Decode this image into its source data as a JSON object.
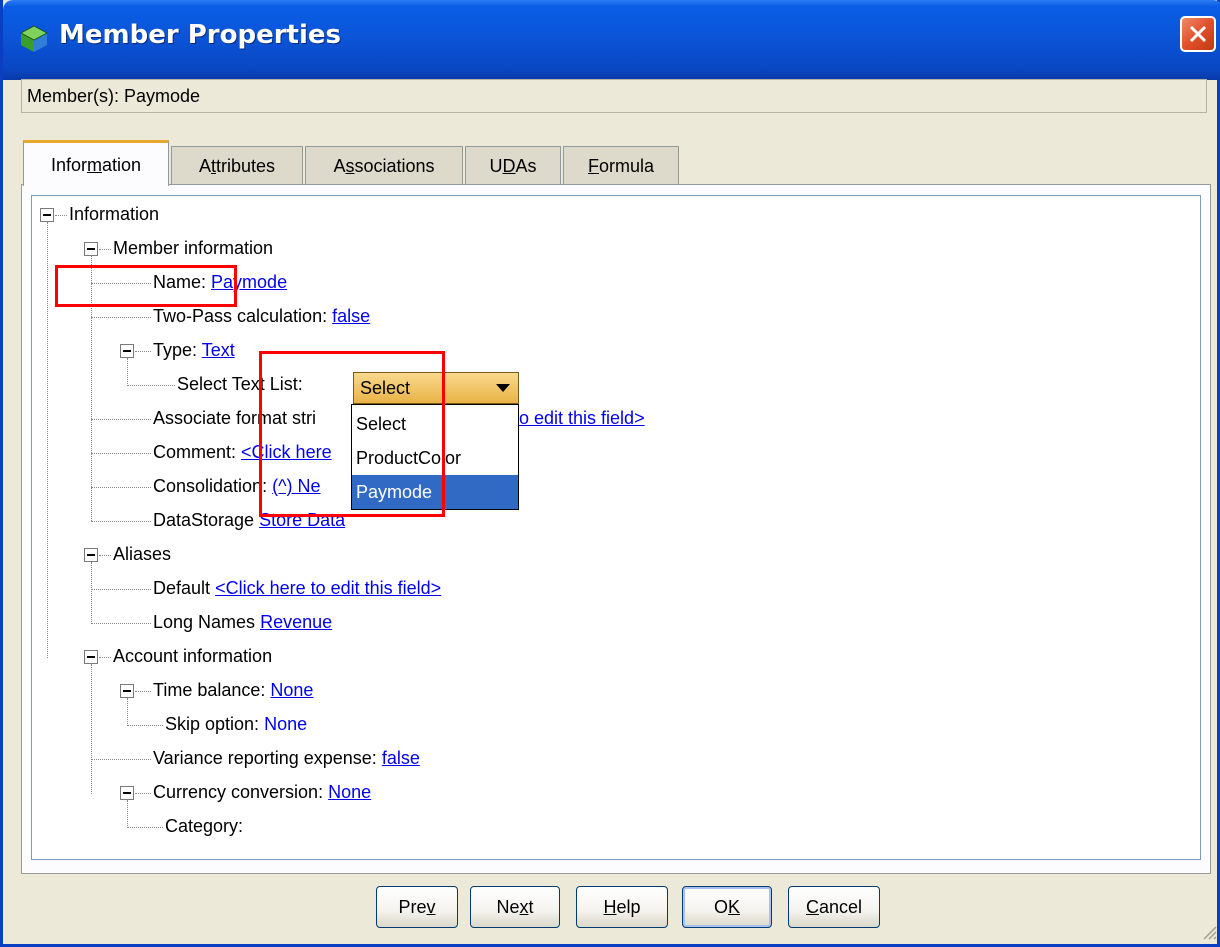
{
  "window": {
    "title": "Member Properties"
  },
  "member": {
    "label": "Member(s): Paymode"
  },
  "tabs": [
    {
      "pre": "Infor",
      "hot": "m",
      "post": "ation",
      "active": true
    },
    {
      "pre": "A",
      "hot": "t",
      "post": "tributes",
      "active": false
    },
    {
      "pre": "A",
      "hot": "s",
      "post": "sociations",
      "active": false
    },
    {
      "pre": "U",
      "hot": "D",
      "post": "As",
      "active": false
    },
    {
      "pre": "",
      "hot": "F",
      "post": "ormula",
      "active": false
    }
  ],
  "tree": {
    "root": "Information",
    "member_info": "Member information",
    "name_label": "Name:",
    "name_value": "Paymode",
    "twopass_label": "Two-Pass calculation:",
    "twopass_value": "false",
    "type_label": "Type:",
    "type_value": "Text",
    "select_text_list_label": "Select Text List:",
    "associate_label": "Associate format stri",
    "associate_value_tail": "o edit this field>",
    "comment_label": "Comment:",
    "comment_value": "<Click here",
    "consolidation_label": "Consolidation:",
    "consolidation_value": "(^) Ne",
    "datastorage_label": "DataStorage",
    "datastorage_value": "Store Data",
    "aliases": "Aliases",
    "default_label": "Default",
    "default_value": "<Click here to edit this field>",
    "longnames_label": "Long Names",
    "longnames_value": "Revenue",
    "account_info": "Account information",
    "timebalance_label": "Time balance:",
    "timebalance_value": "None",
    "skip_label": "Skip option:",
    "skip_value": "None",
    "variance_label": "Variance reporting expense:",
    "variance_value": "false",
    "currency_label": "Currency conversion:",
    "currency_value": "None",
    "category_label": "Category:"
  },
  "dropdown": {
    "selected": "Select",
    "options": [
      "Select",
      "ProductColor",
      "Paymode"
    ],
    "highlighted_option": "Paymode"
  },
  "buttons": {
    "prev": {
      "pre": "Pre",
      "hot": "v",
      "post": ""
    },
    "next": {
      "pre": "Ne",
      "hot": "x",
      "post": "t"
    },
    "help": {
      "pre": "",
      "hot": "H",
      "post": "elp"
    },
    "ok": {
      "pre": "O",
      "hot": "K",
      "post": ""
    },
    "cancel": {
      "pre": "",
      "hot": "C",
      "post": "ancel"
    }
  },
  "colors": {
    "title_bar": "#0a5ee6",
    "highlight_box": "#ff0000",
    "link": "#0000ee",
    "selected_option": "#316ac5",
    "active_tab_accent": "#e6a82c"
  },
  "icons": {
    "app": "member-cube-icon",
    "close": "close-x-icon"
  }
}
